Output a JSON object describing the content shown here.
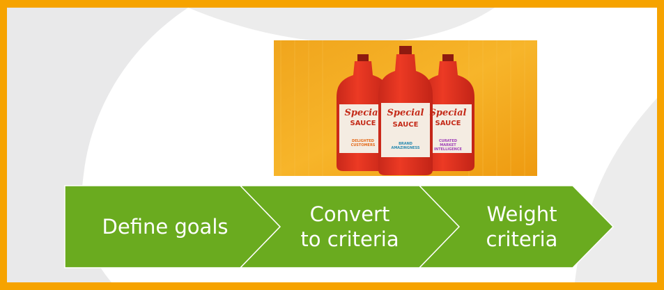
{
  "process": {
    "steps": [
      {
        "label": "Define goals"
      },
      {
        "label": "Convert\nto criteria"
      },
      {
        "label": "Weight\ncriteria"
      }
    ]
  },
  "image": {
    "bottles": [
      {
        "brand": "Special",
        "product": "SAUCE",
        "tagline": "DELIGHTED\nCUSTOMERS"
      },
      {
        "brand": "Special",
        "product": "SAUCE",
        "tagline": "BRAND\nAMAZINGNESS"
      },
      {
        "brand": "Special",
        "product": "SAUCE",
        "tagline": "CURATED\nMARKET\nINTELLIGENCE"
      }
    ]
  },
  "colors": {
    "border": "#f6a300",
    "chevron": "#6aab1f",
    "chevron_stroke": "#ffffff",
    "background_shape": "#e9e9ea",
    "photo_bg": "#f5a91a",
    "bottle": "#e8321f"
  }
}
